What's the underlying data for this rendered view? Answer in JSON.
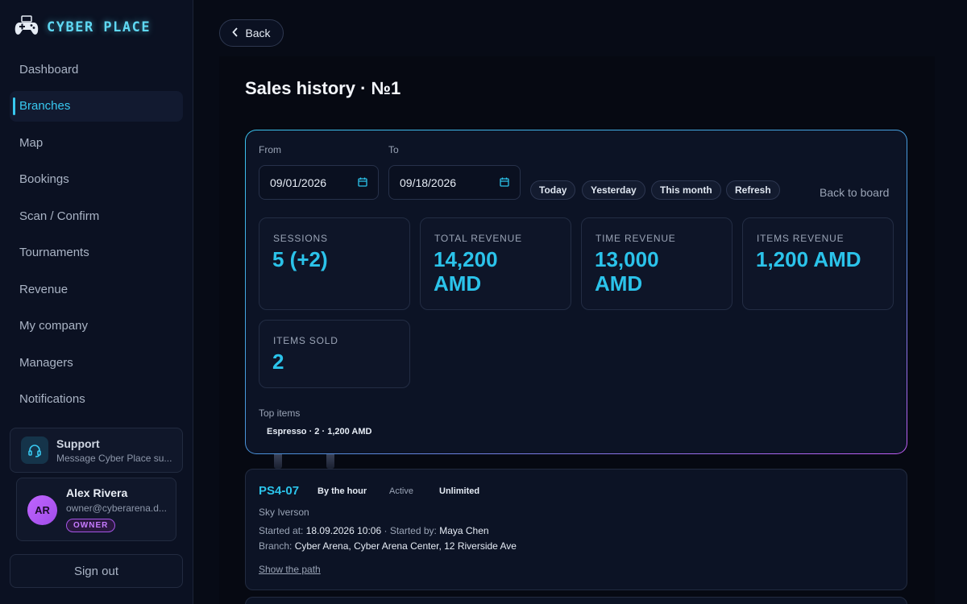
{
  "app": {
    "name": "CYBER PLACE"
  },
  "sidebar": {
    "items": [
      {
        "label": "Dashboard"
      },
      {
        "label": "Branches"
      },
      {
        "label": "Map"
      },
      {
        "label": "Bookings"
      },
      {
        "label": "Scan / Confirm"
      },
      {
        "label": "Tournaments"
      },
      {
        "label": "Revenue"
      },
      {
        "label": "My company"
      },
      {
        "label": "Managers"
      },
      {
        "label": "Notifications"
      }
    ],
    "support": {
      "title": "Support",
      "subtitle": "Message Cyber Place su..."
    },
    "user": {
      "initials": "AR",
      "name": "Alex Rivera",
      "email": "owner@cyberarena.d...",
      "role": "OWNER"
    },
    "signout_label": "Sign out"
  },
  "header": {
    "back_label": "Back",
    "title": "Sales history · №1"
  },
  "filters": {
    "from_label": "From",
    "from_value": "09/01/2026",
    "to_label": "To",
    "to_value": "09/18/2026",
    "chips": [
      "Today",
      "Yesterday",
      "This month",
      "Refresh"
    ],
    "back_to_board": "Back to board"
  },
  "stats": [
    {
      "label": "SESSIONS",
      "value": "5 (+2)"
    },
    {
      "label": "TOTAL REVENUE",
      "value": "14,200 AMD"
    },
    {
      "label": "TIME REVENUE",
      "value": "13,000 AMD"
    },
    {
      "label": "ITEMS REVENUE",
      "value": "1,200 AMD"
    },
    {
      "label": "ITEMS SOLD",
      "value": "2"
    }
  ],
  "top_items": {
    "label": "Top items",
    "items": [
      "Espresso · 2 · 1,200 AMD"
    ]
  },
  "session": {
    "id": "PS4-07",
    "tags": [
      "By the hour",
      "Active",
      "Unlimited"
    ],
    "customer": "Sky Iverson",
    "started_at_label": "Started at:",
    "started_at": "18.09.2026 10:06",
    "started_by_label": "· Started by:",
    "started_by": "Maya Chen",
    "branch_label": "Branch:",
    "branch": "Cyber Arena, Cyber Arena Center, 12 Riverside Ave",
    "path_link": "Show the path"
  },
  "colors": {
    "accent": "#2bc3ea",
    "role": "#c77bff",
    "background": "#070b16"
  }
}
